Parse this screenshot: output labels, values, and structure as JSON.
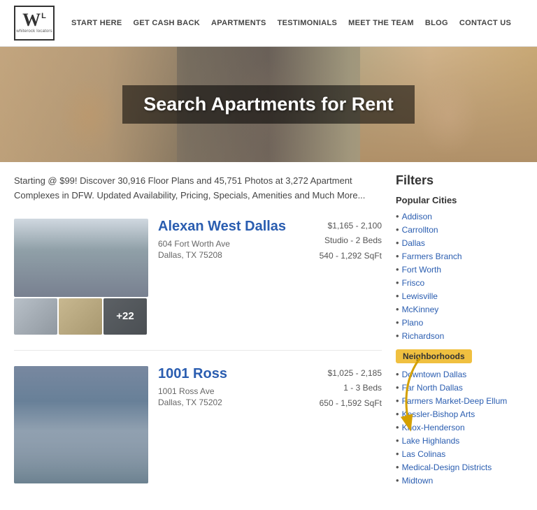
{
  "header": {
    "logo_main": "W",
    "logo_super": "L",
    "logo_sub": "whiterock locators",
    "nav": [
      {
        "label": "START HERE",
        "url": "#"
      },
      {
        "label": "GET CASH BACK",
        "url": "#"
      },
      {
        "label": "APARTMENTS",
        "url": "#"
      },
      {
        "label": "TESTIMONIALS",
        "url": "#"
      },
      {
        "label": "MEET THE TEAM",
        "url": "#"
      },
      {
        "label": "BLOG",
        "url": "#"
      },
      {
        "label": "CONTACT US",
        "url": "#"
      }
    ]
  },
  "hero": {
    "title": "Search Apartments for Rent"
  },
  "intro": {
    "text": "Starting @ $99! Discover 30,916 Floor Plans and 45,751 Photos at 3,272 Apartment Complexes in DFW. Updated Availability, Pricing, Specials, Amenities and Much More..."
  },
  "listings": [
    {
      "name": "Alexan West Dallas",
      "address": "604 Fort Worth Ave",
      "city_state_zip": "Dallas, TX 75208",
      "price_range": "$1,165 - 2,100",
      "beds": "Studio - 2 Beds",
      "sqft": "540 - 1,292 SqFt",
      "photo_count": "+22"
    },
    {
      "name": "1001 Ross",
      "address": "1001 Ross Ave",
      "city_state_zip": "Dallas, TX 75202",
      "price_range": "$1,025 - 2,185",
      "beds": "1 - 3 Beds",
      "sqft": "650 - 1,592 SqFt"
    }
  ],
  "filters": {
    "title": "Filters",
    "popular_cities_title": "Popular Cities",
    "popular_cities": [
      {
        "label": "Addison"
      },
      {
        "label": "Carrollton"
      },
      {
        "label": "Dallas"
      },
      {
        "label": "Farmers Branch"
      },
      {
        "label": "Fort Worth"
      },
      {
        "label": "Frisco"
      },
      {
        "label": "Lewisville"
      },
      {
        "label": "McKinney"
      },
      {
        "label": "Plano"
      },
      {
        "label": "Richardson"
      }
    ],
    "neighborhoods_label": "Neighborhoods",
    "neighborhoods": [
      {
        "label": "Downtown Dallas"
      },
      {
        "label": "Far North Dallas"
      },
      {
        "label": "Farmers Market-Deep Ellum"
      },
      {
        "label": "Kessler-Bishop Arts"
      },
      {
        "label": "Knox-Henderson"
      },
      {
        "label": "Lake Highlands"
      },
      {
        "label": "Las Colinas"
      },
      {
        "label": "Medical-Design Districts"
      },
      {
        "label": "Midtown"
      }
    ]
  }
}
